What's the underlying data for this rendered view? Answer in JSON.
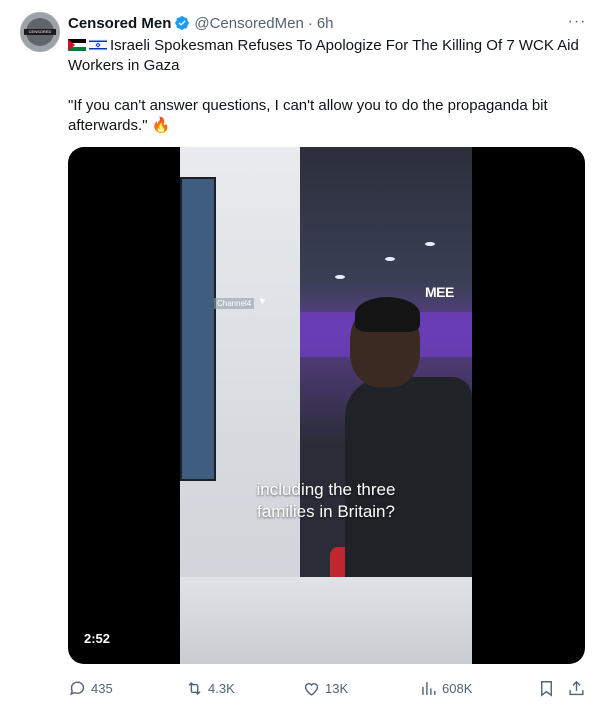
{
  "tweet": {
    "author_name": "Censored Men",
    "handle": "@CensoredMen",
    "separator": "·",
    "time": "6h",
    "more_icon": "more-horizontal-icon",
    "verified_color": "#1d9bf0",
    "avatar_label": "CENSORED",
    "line1": "Israeli Spokesman Refuses To Apologize For The Killing Of 7 WCK Aid Workers in Gaza",
    "line2": "\"If you can't answer questions, I can't allow you to do the propaganda bit afterwards.\" 🔥",
    "flags": [
      "palestine-flag-icon",
      "israel-flag-icon"
    ]
  },
  "media": {
    "caption_line1": "including the three",
    "caption_line2": "families in Britain?",
    "watermark": "MEE",
    "channel_tag": "Channel4",
    "duration": "2:52"
  },
  "actions": {
    "replies": "435",
    "reposts": "4.3K",
    "likes": "13K",
    "views": "608K"
  }
}
